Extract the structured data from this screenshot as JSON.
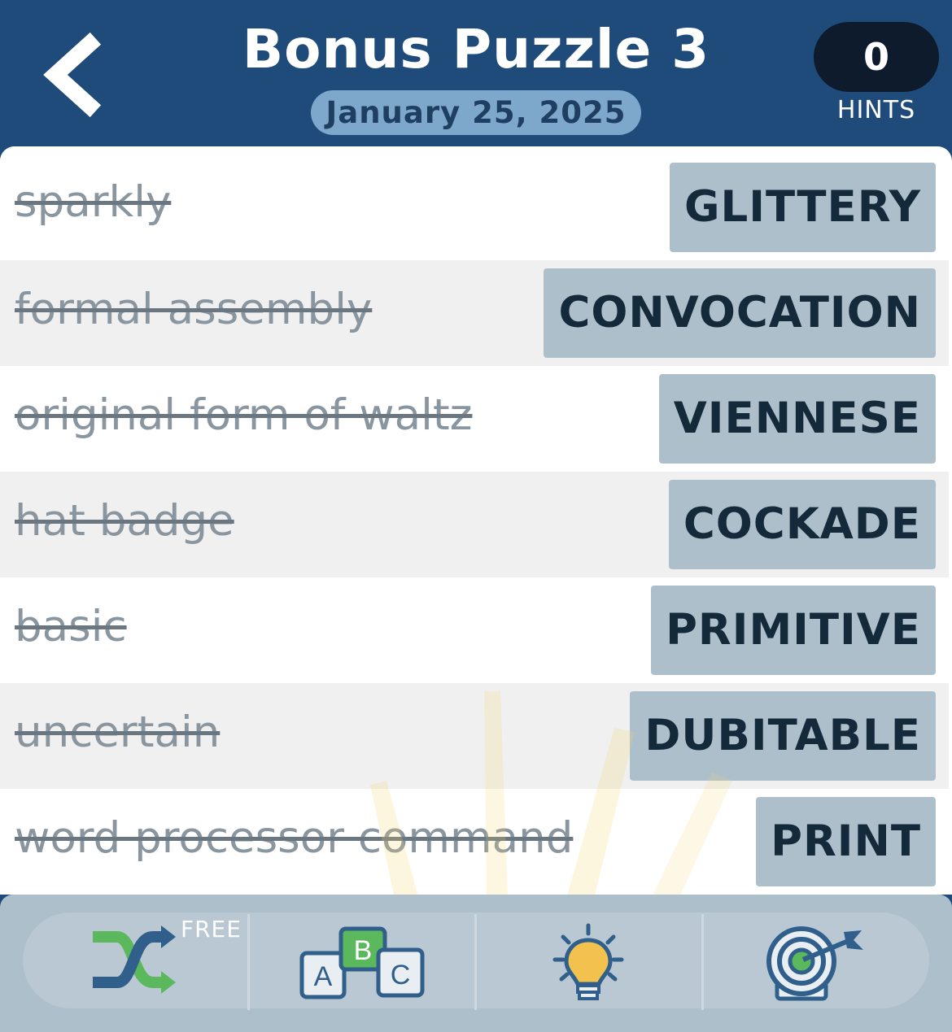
{
  "header": {
    "title": "Bonus Puzzle 3",
    "date": "January 25, 2025",
    "hints_count": "0",
    "hints_label": "HINTS"
  },
  "rows": [
    {
      "clue": "sparkly",
      "answer": "GLITTERY"
    },
    {
      "clue": "formal assembly",
      "answer": "CONVOCATION"
    },
    {
      "clue": "original form of waltz",
      "answer": "VIENNESE"
    },
    {
      "clue": "hat badge",
      "answer": "COCKADE"
    },
    {
      "clue": "basic",
      "answer": "PRIMITIVE"
    },
    {
      "clue": "uncertain",
      "answer": "DUBITABLE"
    },
    {
      "clue": "word processor command",
      "answer": "PRINT"
    }
  ],
  "toolbar": {
    "shuffle_icon": "shuffle-icon",
    "free_label": "FREE",
    "letters_icon": "letter-blocks-icon",
    "letters": [
      "A",
      "B",
      "C"
    ],
    "hint_icon": "lightbulb-icon",
    "target_icon": "target-icon"
  },
  "colors": {
    "header_bg": "#1f4b7a",
    "answer_bg": "#aebfcc",
    "date_pill": "#7ea7cc",
    "shuffle_green": "#5cb85c",
    "shuffle_blue": "#2f5f8a"
  }
}
